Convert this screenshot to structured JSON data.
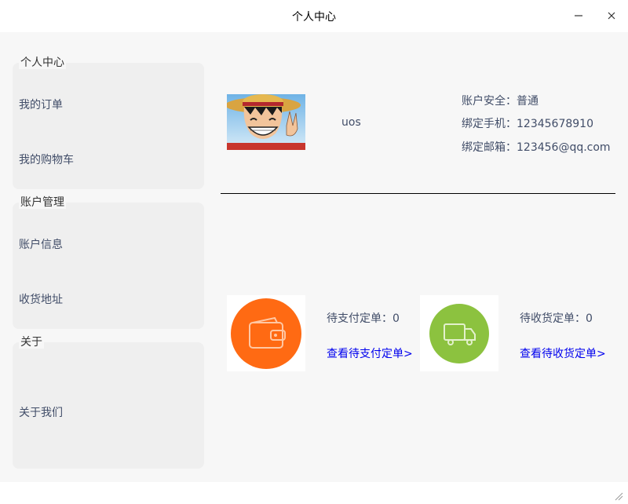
{
  "window": {
    "title": "个人中心",
    "minimize_icon": "minimize-icon",
    "close_icon": "close-icon"
  },
  "sidebar": {
    "groups": [
      {
        "title": "个人中心",
        "items": [
          {
            "label": "我的订单"
          },
          {
            "label": "我的购物车"
          }
        ]
      },
      {
        "title": "账户管理",
        "items": [
          {
            "label": "账户信息"
          },
          {
            "label": "收货地址"
          }
        ]
      },
      {
        "title": "关于",
        "items": [
          {
            "label": "关于我们"
          }
        ]
      }
    ]
  },
  "profile": {
    "avatar": "avatar-image",
    "username": "uos",
    "security": "账户安全：普通",
    "phone": "绑定手机：12345678910",
    "email": "绑定邮箱：123456@qq.com"
  },
  "orders": {
    "pending_payment": {
      "label": "待支付定单：0",
      "link": "查看待支付定单>",
      "icon": "wallet-icon",
      "color": "#ff6a13"
    },
    "pending_receipt": {
      "label": "待收货定单：0",
      "link": "查看待收货定单>",
      "icon": "truck-icon",
      "color": "#8cc23f"
    }
  },
  "colors": {
    "link": "#0000ee",
    "background": "#f7f7f7"
  }
}
